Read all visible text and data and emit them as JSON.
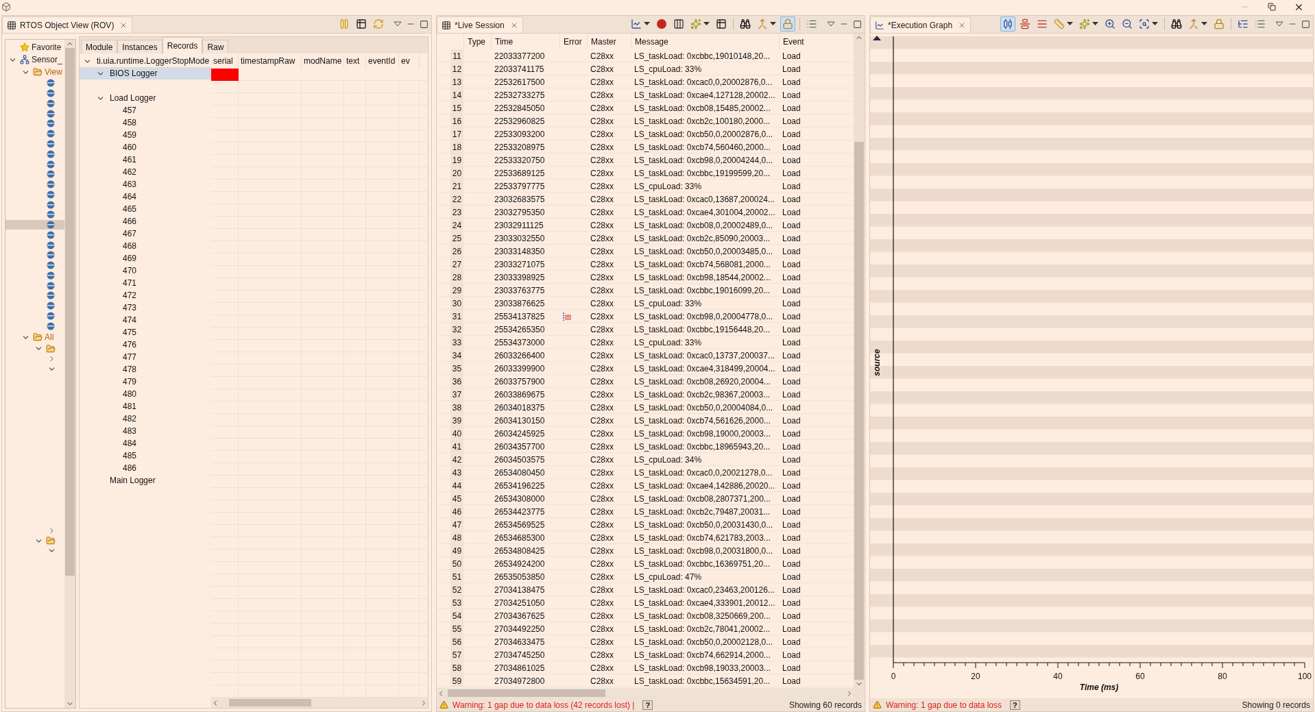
{
  "rov": {
    "title": "RTOS Object View (ROV)",
    "toolbar": [
      {
        "kind": "pause",
        "on": false,
        "has_menu": false
      },
      {
        "kind": "fit",
        "on": false,
        "has_menu": false
      },
      {
        "kind": "sync",
        "on": false,
        "has_menu": false
      }
    ],
    "nav_tree": [
      {
        "kind": "favorites",
        "label": "Favorite"
      },
      {
        "kind": "project",
        "label": "Sensor_",
        "expanded": true,
        "children": [
          {
            "kind": "folder",
            "label": "View",
            "expanded": true,
            "children": [
              {
                "kind": "item",
                "selected": false
              },
              {
                "kind": "item",
                "selected": false
              },
              {
                "kind": "item",
                "selected": false
              },
              {
                "kind": "item",
                "selected": false
              },
              {
                "kind": "item",
                "selected": false
              },
              {
                "kind": "item",
                "selected": false
              },
              {
                "kind": "item",
                "selected": false
              },
              {
                "kind": "item",
                "selected": false
              },
              {
                "kind": "item",
                "selected": false
              },
              {
                "kind": "item",
                "selected": false
              },
              {
                "kind": "item",
                "selected": false
              },
              {
                "kind": "item",
                "selected": false
              },
              {
                "kind": "item",
                "selected": false
              },
              {
                "kind": "item",
                "selected": false
              },
              {
                "kind": "item",
                "selected": true
              },
              {
                "kind": "item",
                "selected": false
              },
              {
                "kind": "item",
                "selected": false
              },
              {
                "kind": "item",
                "selected": false
              },
              {
                "kind": "item",
                "selected": false
              },
              {
                "kind": "item",
                "selected": false
              },
              {
                "kind": "item",
                "selected": false
              },
              {
                "kind": "item",
                "selected": false
              },
              {
                "kind": "item",
                "selected": false
              },
              {
                "kind": "item",
                "selected": false
              },
              {
                "kind": "item",
                "selected": false
              }
            ]
          },
          {
            "kind": "folder",
            "label": "All",
            "expanded": true,
            "children": [
              {
                "kind": "folder",
                "expanded": true,
                "children": [
                  {
                    "kind": "node",
                    "expanded": false
                  },
                  {
                    "kind": "node",
                    "expanded": true
                  },
                  {
                    "kind": "node",
                    "expanded": false
                  }
                ]
              },
              {
                "kind": "folder",
                "expanded": true,
                "children": [
                  {
                    "kind": "node",
                    "expanded": true
                  }
                ]
              }
            ]
          }
        ]
      }
    ],
    "tabs": [
      {
        "label": "Module",
        "selected": false
      },
      {
        "label": "Instances",
        "selected": false
      },
      {
        "label": "Records",
        "selected": true
      },
      {
        "label": "Raw",
        "selected": false
      }
    ],
    "logger_tree": [
      {
        "label": "ti.uia.runtime.LoggerStopMode",
        "expanded": true,
        "selected": false,
        "children": [
          {
            "label": "BIOS Logger",
            "expanded": true,
            "selected": true
          },
          {
            "label": "Load Logger",
            "expanded": true,
            "selected": false,
            "children": [
              {
                "label": "457",
                "selected": false
              },
              {
                "label": "458",
                "selected": false
              },
              {
                "label": "459",
                "selected": false
              },
              {
                "label": "460",
                "selected": false
              },
              {
                "label": "461",
                "selected": false
              },
              {
                "label": "462",
                "selected": false
              },
              {
                "label": "463",
                "selected": false
              },
              {
                "label": "464",
                "selected": false
              },
              {
                "label": "465",
                "selected": false
              },
              {
                "label": "466",
                "selected": false
              },
              {
                "label": "467",
                "selected": false
              },
              {
                "label": "468",
                "selected": false
              },
              {
                "label": "469",
                "selected": false
              },
              {
                "label": "470",
                "selected": false
              },
              {
                "label": "471",
                "selected": false
              },
              {
                "label": "472",
                "selected": false
              },
              {
                "label": "473",
                "selected": false
              },
              {
                "label": "474",
                "selected": false
              },
              {
                "label": "475",
                "selected": false
              },
              {
                "label": "476",
                "selected": false
              },
              {
                "label": "477",
                "selected": false
              },
              {
                "label": "478",
                "selected": false
              },
              {
                "label": "479",
                "selected": false
              },
              {
                "label": "480",
                "selected": false
              },
              {
                "label": "481",
                "selected": false
              },
              {
                "label": "482",
                "selected": false
              },
              {
                "label": "483",
                "selected": false
              },
              {
                "label": "484",
                "selected": false
              },
              {
                "label": "485",
                "selected": false
              },
              {
                "label": "486",
                "selected": false
              }
            ]
          },
          {
            "label": "Main Logger",
            "selected": false
          }
        ]
      }
    ],
    "table": {
      "columns": [
        "serial",
        "timestampRaw",
        "modName",
        "text",
        "eventId",
        "ev"
      ],
      "rows": [
        {
          "flagged": true
        }
      ]
    }
  },
  "live": {
    "title": "*Live Session",
    "toolbar": [
      {
        "kind": "chart",
        "on": false,
        "has_menu": true
      },
      {
        "kind": "record",
        "on": false,
        "has_menu": false
      },
      {
        "kind": "columns",
        "on": false,
        "has_menu": false
      },
      {
        "kind": "star",
        "on": false,
        "has_menu": true
      },
      {
        "kind": "fit",
        "on": false,
        "has_menu": false
      },
      {
        "kind": "separator"
      },
      {
        "kind": "binoculars",
        "on": false,
        "has_menu": false
      },
      {
        "kind": "merge",
        "on": false,
        "has_menu": true
      },
      {
        "kind": "lock",
        "on": true,
        "has_menu": false
      },
      {
        "kind": "separator"
      },
      {
        "kind": "list",
        "on": false,
        "has_menu": false
      }
    ],
    "columns": [
      "Type",
      "Time",
      "Error",
      "Master",
      "Message",
      "Event"
    ],
    "rows": [
      {
        "n": "11",
        "time": "22033377200",
        "error": false,
        "master": "C28xx",
        "message": "LS_taskLoad: 0xcbbc,19010148,20...",
        "event": "Load"
      },
      {
        "n": "12",
        "time": "22033741175",
        "error": false,
        "master": "C28xx",
        "message": "LS_cpuLoad: 33%",
        "event": "Load"
      },
      {
        "n": "13",
        "time": "22532617500",
        "error": false,
        "master": "C28xx",
        "message": "LS_taskLoad: 0xcac0,0,20002876,0...",
        "event": "Load"
      },
      {
        "n": "14",
        "time": "22532733275",
        "error": false,
        "master": "C28xx",
        "message": "LS_taskLoad: 0xcae4,127128,20002...",
        "event": "Load"
      },
      {
        "n": "15",
        "time": "22532845050",
        "error": false,
        "master": "C28xx",
        "message": "LS_taskLoad: 0xcb08,15485,20002...",
        "event": "Load"
      },
      {
        "n": "16",
        "time": "22532960825",
        "error": false,
        "master": "C28xx",
        "message": "LS_taskLoad: 0xcb2c,100180,2000...",
        "event": "Load"
      },
      {
        "n": "17",
        "time": "22533093200",
        "error": false,
        "master": "C28xx",
        "message": "LS_taskLoad: 0xcb50,0,20002876,0...",
        "event": "Load"
      },
      {
        "n": "18",
        "time": "22533208975",
        "error": false,
        "master": "C28xx",
        "message": "LS_taskLoad: 0xcb74,560460,2000...",
        "event": "Load"
      },
      {
        "n": "19",
        "time": "22533320750",
        "error": false,
        "master": "C28xx",
        "message": "LS_taskLoad: 0xcb98,0,20004244,0...",
        "event": "Load"
      },
      {
        "n": "20",
        "time": "22533689125",
        "error": false,
        "master": "C28xx",
        "message": "LS_taskLoad: 0xcbbc,19199599,20...",
        "event": "Load"
      },
      {
        "n": "21",
        "time": "22533797775",
        "error": false,
        "master": "C28xx",
        "message": "LS_cpuLoad: 33%",
        "event": "Load"
      },
      {
        "n": "22",
        "time": "23032683575",
        "error": false,
        "master": "C28xx",
        "message": "LS_taskLoad: 0xcac0,13687,200024...",
        "event": "Load"
      },
      {
        "n": "23",
        "time": "23032795350",
        "error": false,
        "master": "C28xx",
        "message": "LS_taskLoad: 0xcae4,301004,20002...",
        "event": "Load"
      },
      {
        "n": "24",
        "time": "23032911125",
        "error": false,
        "master": "C28xx",
        "message": "LS_taskLoad: 0xcb08,0,20002489,0...",
        "event": "Load"
      },
      {
        "n": "25",
        "time": "23033032550",
        "error": false,
        "master": "C28xx",
        "message": "LS_taskLoad: 0xcb2c,85090,20003...",
        "event": "Load"
      },
      {
        "n": "26",
        "time": "23033148350",
        "error": false,
        "master": "C28xx",
        "message": "LS_taskLoad: 0xcb50,0,20003485,0...",
        "event": "Load"
      },
      {
        "n": "27",
        "time": "23033271075",
        "error": false,
        "master": "C28xx",
        "message": "LS_taskLoad: 0xcb74,568081,2000...",
        "event": "Load"
      },
      {
        "n": "28",
        "time": "23033398925",
        "error": false,
        "master": "C28xx",
        "message": "LS_taskLoad: 0xcb98,18544,20002...",
        "event": "Load"
      },
      {
        "n": "29",
        "time": "23033763775",
        "error": false,
        "master": "C28xx",
        "message": "LS_taskLoad: 0xcbbc,19016099,20...",
        "event": "Load"
      },
      {
        "n": "30",
        "time": "23033876625",
        "error": false,
        "master": "C28xx",
        "message": "LS_cpuLoad: 33%",
        "event": "Load"
      },
      {
        "n": "31",
        "time": "25534137825",
        "error": true,
        "master": "C28xx",
        "message": "LS_taskLoad: 0xcb98,0,20004778,0...",
        "event": "Load"
      },
      {
        "n": "32",
        "time": "25534265350",
        "error": false,
        "master": "C28xx",
        "message": "LS_taskLoad: 0xcbbc,19156448,20...",
        "event": "Load"
      },
      {
        "n": "33",
        "time": "25534373000",
        "error": false,
        "master": "C28xx",
        "message": "LS_cpuLoad: 33%",
        "event": "Load"
      },
      {
        "n": "34",
        "time": "26033266400",
        "error": false,
        "master": "C28xx",
        "message": "LS_taskLoad: 0xcac0,13737,200037...",
        "event": "Load"
      },
      {
        "n": "35",
        "time": "26033399900",
        "error": false,
        "master": "C28xx",
        "message": "LS_taskLoad: 0xcae4,318499,20004...",
        "event": "Load"
      },
      {
        "n": "36",
        "time": "26033757900",
        "error": false,
        "master": "C28xx",
        "message": "LS_taskLoad: 0xcb08,26920,20004...",
        "event": "Load"
      },
      {
        "n": "37",
        "time": "26033869675",
        "error": false,
        "master": "C28xx",
        "message": "LS_taskLoad: 0xcb2c,98367,20003...",
        "event": "Load"
      },
      {
        "n": "38",
        "time": "26034018375",
        "error": false,
        "master": "C28xx",
        "message": "LS_taskLoad: 0xcb50,0,20004084,0...",
        "event": "Load"
      },
      {
        "n": "39",
        "time": "26034130150",
        "error": false,
        "master": "C28xx",
        "message": "LS_taskLoad: 0xcb74,561626,2000...",
        "event": "Load"
      },
      {
        "n": "40",
        "time": "26034245925",
        "error": false,
        "master": "C28xx",
        "message": "LS_taskLoad: 0xcb98,19000,20003...",
        "event": "Load"
      },
      {
        "n": "41",
        "time": "26034357700",
        "error": false,
        "master": "C28xx",
        "message": "LS_taskLoad: 0xcbbc,18965943,20...",
        "event": "Load"
      },
      {
        "n": "42",
        "time": "26034503575",
        "error": false,
        "master": "C28xx",
        "message": "LS_cpuLoad: 34%",
        "event": "Load"
      },
      {
        "n": "43",
        "time": "26534080450",
        "error": false,
        "master": "C28xx",
        "message": "LS_taskLoad: 0xcac0,0,20021278,0...",
        "event": "Load"
      },
      {
        "n": "44",
        "time": "26534196225",
        "error": false,
        "master": "C28xx",
        "message": "LS_taskLoad: 0xcae4,142886,20020...",
        "event": "Load"
      },
      {
        "n": "45",
        "time": "26534308000",
        "error": false,
        "master": "C28xx",
        "message": "LS_taskLoad: 0xcb08,2807371,200...",
        "event": "Load"
      },
      {
        "n": "46",
        "time": "26534423775",
        "error": false,
        "master": "C28xx",
        "message": "LS_taskLoad: 0xcb2c,79487,20031...",
        "event": "Load"
      },
      {
        "n": "47",
        "time": "26534569525",
        "error": false,
        "master": "C28xx",
        "message": "LS_taskLoad: 0xcb50,0,20031430,0...",
        "event": "Load"
      },
      {
        "n": "48",
        "time": "26534685300",
        "error": false,
        "master": "C28xx",
        "message": "LS_taskLoad: 0xcb74,621783,2003...",
        "event": "Load"
      },
      {
        "n": "49",
        "time": "26534808425",
        "error": false,
        "master": "C28xx",
        "message": "LS_taskLoad: 0xcb98,0,20031800,0...",
        "event": "Load"
      },
      {
        "n": "50",
        "time": "26534924200",
        "error": false,
        "master": "C28xx",
        "message": "LS_taskLoad: 0xcbbc,16369751,20...",
        "event": "Load"
      },
      {
        "n": "51",
        "time": "26535053850",
        "error": false,
        "master": "C28xx",
        "message": "LS_cpuLoad: 47%",
        "event": "Load"
      },
      {
        "n": "52",
        "time": "27034138475",
        "error": false,
        "master": "C28xx",
        "message": "LS_taskLoad: 0xcac0,23463,200126...",
        "event": "Load"
      },
      {
        "n": "53",
        "time": "27034251050",
        "error": false,
        "master": "C28xx",
        "message": "LS_taskLoad: 0xcae4,333901,20012...",
        "event": "Load"
      },
      {
        "n": "54",
        "time": "27034367625",
        "error": false,
        "master": "C28xx",
        "message": "LS_taskLoad: 0xcb08,3250669,200...",
        "event": "Load"
      },
      {
        "n": "55",
        "time": "27034492250",
        "error": false,
        "master": "C28xx",
        "message": "LS_taskLoad: 0xcb2c,78041,20002...",
        "event": "Load"
      },
      {
        "n": "56",
        "time": "27034633475",
        "error": false,
        "master": "C28xx",
        "message": "LS_taskLoad: 0xcb50,0,20002128,0...",
        "event": "Load"
      },
      {
        "n": "57",
        "time": "27034745250",
        "error": false,
        "master": "C28xx",
        "message": "LS_taskLoad: 0xcb74,662914,2000...",
        "event": "Load"
      },
      {
        "n": "58",
        "time": "27034861025",
        "error": false,
        "master": "C28xx",
        "message": "LS_taskLoad: 0xcb98,19033,20003...",
        "event": "Load"
      },
      {
        "n": "59",
        "time": "27034972800",
        "error": false,
        "master": "C28xx",
        "message": "LS_taskLoad: 0xcbbc,15634591,20...",
        "event": "Load"
      }
    ],
    "status": {
      "warning": "Warning: 1 gap due to data loss (42 records lost) |",
      "help": "?",
      "count": "Showing 60 records"
    }
  },
  "graph": {
    "title": "*Execution Graph",
    "toolbar": [
      {
        "kind": "align",
        "on": true,
        "has_menu": false
      },
      {
        "kind": "center",
        "on": false,
        "has_menu": false
      },
      {
        "kind": "lines",
        "on": false,
        "has_menu": false
      },
      {
        "kind": "ruler",
        "on": false,
        "has_menu": true
      },
      {
        "kind": "star",
        "on": false,
        "has_menu": true
      },
      {
        "kind": "zoom_in",
        "on": false,
        "has_menu": false
      },
      {
        "kind": "zoom_out",
        "on": false,
        "has_menu": false
      },
      {
        "kind": "zoom_fit",
        "on": false,
        "has_menu": true
      },
      {
        "kind": "separator"
      },
      {
        "kind": "binoculars",
        "on": false,
        "has_menu": false
      },
      {
        "kind": "merge",
        "on": false,
        "has_menu": true
      },
      {
        "kind": "lock",
        "on": false,
        "has_menu": false
      },
      {
        "kind": "separator"
      },
      {
        "kind": "tree",
        "on": false,
        "has_menu": false
      },
      {
        "kind": "list",
        "on": false,
        "has_menu": false
      }
    ],
    "timeline": {
      "x_axis_label": "Time (ms)",
      "y_axis_label": "source",
      "x_tick_labels": [
        "0",
        "20",
        "40",
        "60",
        "80",
        "100"
      ]
    },
    "status": {
      "warning": "Warning: 1 gap due to data loss",
      "help": "?",
      "count": "Showing 0 records"
    }
  }
}
